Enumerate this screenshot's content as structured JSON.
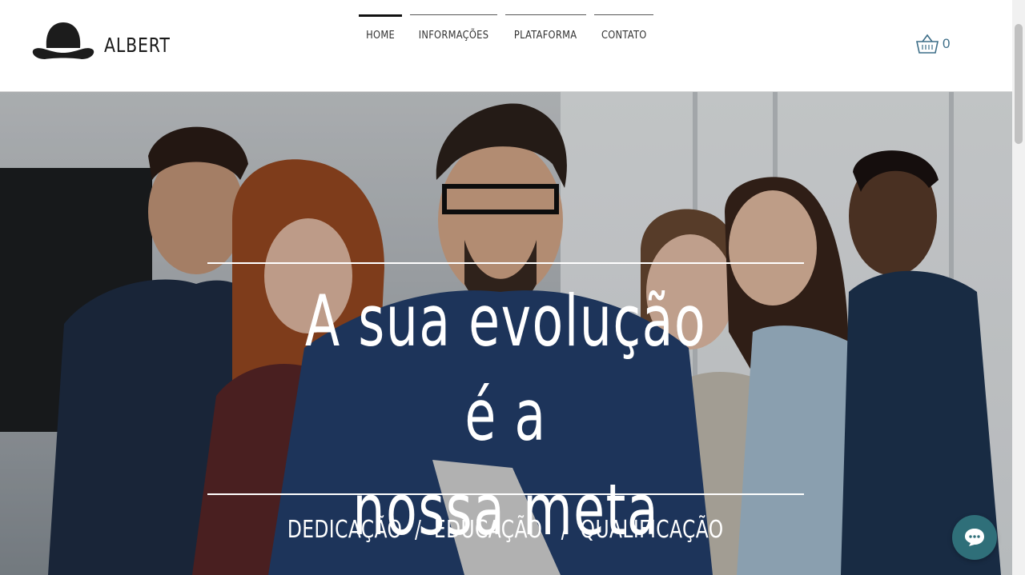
{
  "brand": {
    "name": "ALBERT",
    "logo_icon": "bowler-hat-icon"
  },
  "nav": {
    "items": [
      {
        "label": "HOME",
        "active": true
      },
      {
        "label": "INFORMAÇÕES",
        "active": false
      },
      {
        "label": "PLATAFORMA",
        "active": false
      },
      {
        "label": "CONTATO",
        "active": false
      }
    ]
  },
  "cart": {
    "icon": "shopping-basket-icon",
    "count": "0",
    "color": "#3d6e88"
  },
  "hero": {
    "title_line1": "A sua evolução é a",
    "title_line2": "nossa meta",
    "subtitle": "DEDICAÇÃO  /  EDUCAÇÃO   /  QUALIFICAÇÃO"
  },
  "chat": {
    "icon": "chat-bubble-icon",
    "color": "#2f6f79"
  }
}
